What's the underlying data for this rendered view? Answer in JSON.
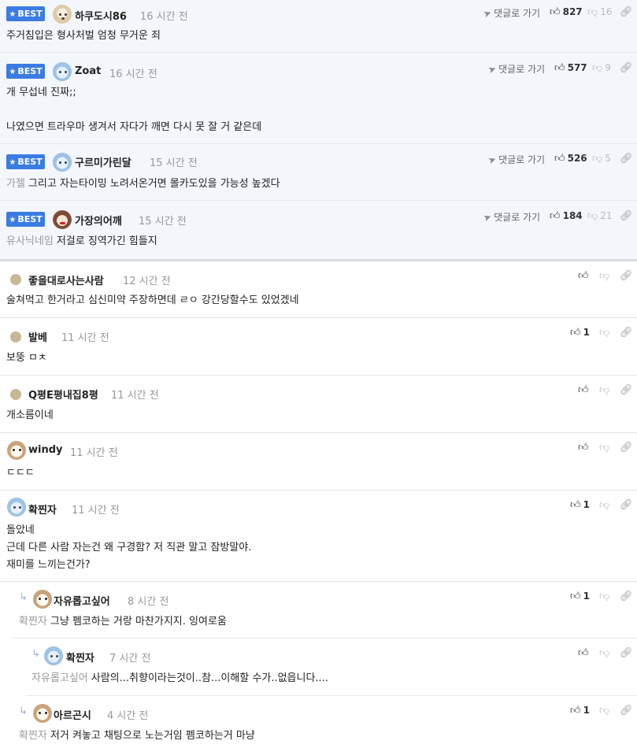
{
  "badge": {
    "label": "BEST"
  },
  "actions": {
    "reply_to": "댓글로 가기"
  },
  "best_comments": [
    {
      "nick": "하쿠도시86",
      "time": "16 시간 전",
      "likes": "827",
      "dislikes": "16",
      "text": "주거침입은 형사처벌 엄청 무거운 죄",
      "avatar": "dog-icon"
    },
    {
      "nick": "Zoat",
      "time": "16 시간 전",
      "likes": "577",
      "dislikes": "9",
      "text_lines": [
        "개 무섭네 진짜;;",
        "",
        "나였으면 트라우마 생겨서 자다가 깨면 다시 못 잘 거 같은데"
      ],
      "avatar": "cat-icon"
    },
    {
      "nick": "구르미가린달",
      "time": "15 시간 전",
      "likes": "526",
      "dislikes": "5",
      "mention": "가젤",
      "text": "그리고 자는타이밍 노려서온거면 몰카도있을 가능성 높겠다",
      "avatar": "cat-icon"
    },
    {
      "nick": "가장의어깨",
      "time": "15 시간 전",
      "likes": "184",
      "dislikes": "21",
      "mention": "유사닉네임",
      "text": "저걸로 징역가긴 힘들지",
      "avatar": "lady-icon"
    }
  ],
  "comments": [
    {
      "nick": "좋을대로사는사람",
      "time": "12 시간 전",
      "likes": "",
      "text": "술쳐먹고 한거라고 심신미약 주장하면데 ㄹㅇ 강간당할수도 있었겠네",
      "avatar": "dot-icon"
    },
    {
      "nick": "발베",
      "time": "11 시간 전",
      "likes": "1",
      "text": "보뚱 ㅁㅊ",
      "avatar": "dot-icon"
    },
    {
      "nick": "Q평E평내집8평",
      "time": "11 시간 전",
      "likes": "",
      "text": "개소름이네",
      "avatar": "dot-icon"
    },
    {
      "nick": "windy",
      "time": "11 시간 전",
      "likes": "",
      "text": "ㄷㄷㄷ",
      "avatar": "pup-icon"
    },
    {
      "nick": "확찐자",
      "time": "11 시간 전",
      "likes": "1",
      "text_lines": [
        "돌았네",
        "근데 다른 사람 자는건 왜 구경함? 저 직관 말고 잠방말야.",
        "재미를 느끼는건가?"
      ],
      "avatar": "cat-icon"
    }
  ],
  "replies": [
    {
      "nick": "자유롭고싶어",
      "time": "8 시간 전",
      "likes": "1",
      "mention": "확찐자",
      "text": "그냥 펨코하는 거랑 마찬가지지. 잉여로움",
      "avatar": "pup-icon"
    },
    {
      "nick": "확찐자",
      "time": "7 시간 전",
      "likes": "",
      "mention": "자유롭고싶어",
      "text": "사람의...취향이라는것이..참...이해할 수가..없읍니다....",
      "avatar": "cat-icon"
    },
    {
      "nick": "아르곤시",
      "time": "4 시간 전",
      "likes": "1",
      "mention": "확찐자",
      "text": "저거 켜놓고 채팅으로 노는거임 펨코하는거 마냥",
      "avatar": "pup-icon"
    }
  ]
}
